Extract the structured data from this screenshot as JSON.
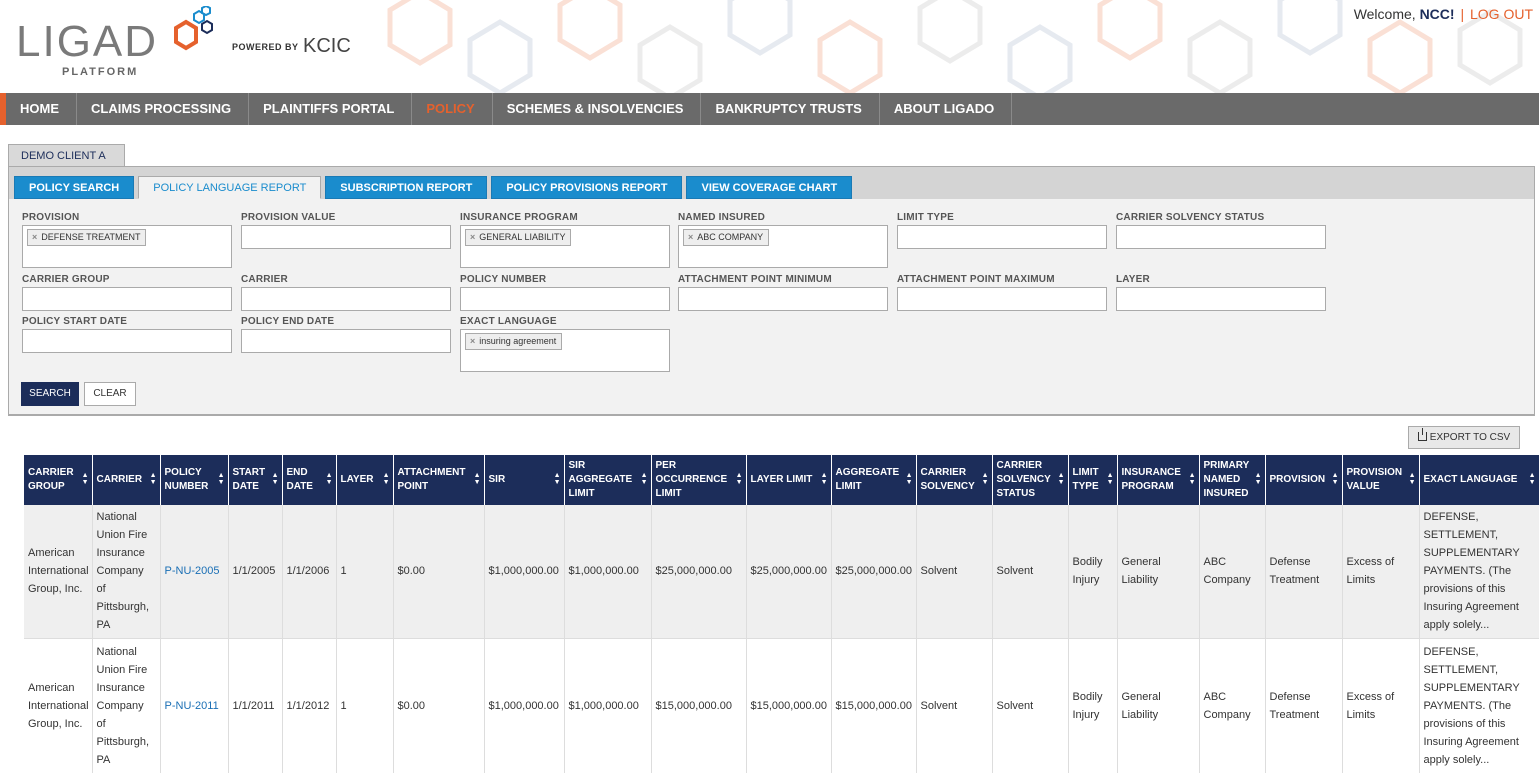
{
  "header": {
    "logo_text": "LIGAD",
    "logo_sub": "PLATFORM",
    "powered_by": "POWERED BY",
    "kcic": "KCIC",
    "welcome_prefix": "Welcome,",
    "user": "NCC!",
    "separator": "|",
    "logout": "LOG OUT"
  },
  "nav": [
    {
      "label": "HOME"
    },
    {
      "label": "CLAIMS PROCESSING"
    },
    {
      "label": "PLAINTIFFS PORTAL"
    },
    {
      "label": "POLICY"
    },
    {
      "label": "SCHEMES & INSOLVENCIES"
    },
    {
      "label": "BANKRUPTCY TRUSTS"
    },
    {
      "label": "ABOUT LIGADO"
    }
  ],
  "client_tab": "DEMO CLIENT A",
  "subtabs": [
    {
      "label": "POLICY SEARCH"
    },
    {
      "label": "POLICY LANGUAGE REPORT"
    },
    {
      "label": "SUBSCRIPTION REPORT"
    },
    {
      "label": "POLICY PROVISIONS REPORT"
    },
    {
      "label": "VIEW COVERAGE CHART"
    }
  ],
  "filters": {
    "provision": {
      "label": "PROVISION",
      "chip": "DEFENSE TREATMENT"
    },
    "provision_value": {
      "label": "PROVISION VALUE"
    },
    "insurance_program": {
      "label": "INSURANCE PROGRAM",
      "chip": "GENERAL LIABILITY"
    },
    "named_insured": {
      "label": "NAMED INSURED",
      "chip": "ABC COMPANY"
    },
    "limit_type": {
      "label": "LIMIT TYPE"
    },
    "carrier_solvency_status": {
      "label": "CARRIER SOLVENCY STATUS"
    },
    "carrier_group": {
      "label": "CARRIER GROUP"
    },
    "carrier": {
      "label": "CARRIER"
    },
    "policy_number": {
      "label": "POLICY NUMBER"
    },
    "attachment_min": {
      "label": "ATTACHMENT POINT MINIMUM"
    },
    "attachment_max": {
      "label": "ATTACHMENT POINT MAXIMUM"
    },
    "layer": {
      "label": "LAYER"
    },
    "policy_start": {
      "label": "POLICY START DATE"
    },
    "policy_end": {
      "label": "POLICY END DATE"
    },
    "exact_language": {
      "label": "EXACT LANGUAGE",
      "chip": "insuring agreement"
    },
    "chip_x": "×"
  },
  "buttons": {
    "search": "SEARCH",
    "clear": "CLEAR",
    "export": "EXPORT TO CSV"
  },
  "table": {
    "columns": [
      "CARRIER GROUP",
      "CARRIER",
      "POLICY NUMBER",
      "START DATE",
      "END DATE",
      "LAYER",
      "ATTACHMENT POINT",
      "SIR",
      "SIR AGGREGATE LIMIT",
      "PER OCCURRENCE LIMIT",
      "LAYER LIMIT",
      "AGGREGATE LIMIT",
      "CARRIER SOLVENCY",
      "CARRIER SOLVENCY STATUS",
      "LIMIT TYPE",
      "INSURANCE PROGRAM",
      "PRIMARY NAMED INSURED",
      "PROVISION",
      "PROVISION VALUE",
      "EXACT LANGUAGE"
    ],
    "rows": [
      [
        "American International Group, Inc.",
        "National Union Fire Insurance Company of Pittsburgh, PA",
        "P-NU-2005",
        "1/1/2005",
        "1/1/2006",
        "1",
        "$0.00",
        "$1,000,000.00",
        "$1,000,000.00",
        "$25,000,000.00",
        "$25,000,000.00",
        "$25,000,000.00",
        "Solvent",
        "Solvent",
        "Bodily Injury",
        "General Liability",
        "ABC Company",
        "Defense Treatment",
        "Excess of Limits",
        "DEFENSE, SETTLEMENT, SUPPLEMENTARY PAYMENTS. (The provisions of this Insuring Agreement apply solely..."
      ],
      [
        "American International Group, Inc.",
        "National Union Fire Insurance Company of Pittsburgh, PA",
        "P-NU-2011",
        "1/1/2011",
        "1/1/2012",
        "1",
        "$0.00",
        "$1,000,000.00",
        "$1,000,000.00",
        "$15,000,000.00",
        "$15,000,000.00",
        "$15,000,000.00",
        "Solvent",
        "Solvent",
        "Bodily Injury",
        "General Liability",
        "ABC Company",
        "Defense Treatment",
        "Excess of Limits",
        "DEFENSE, SETTLEMENT, SUPPLEMENTARY PAYMENTS. (The provisions of this Insuring Agreement apply solely..."
      ]
    ]
  }
}
